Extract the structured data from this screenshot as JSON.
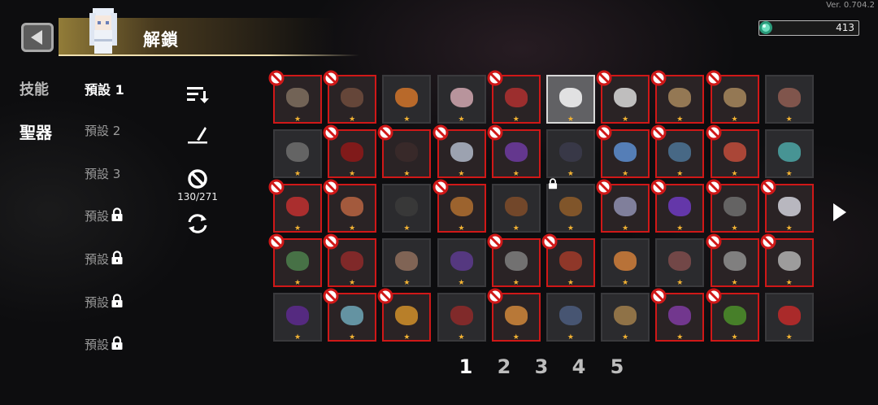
{
  "version": "Ver. 0.704.2",
  "header": {
    "title": "解鎖",
    "currency": "413"
  },
  "nav": {
    "categories": [
      "技能",
      "聖器"
    ],
    "active_category": "聖器"
  },
  "presets": [
    "預設 1",
    "預設 2",
    "預設 3",
    "預設",
    "預設",
    "預設",
    "預設"
  ],
  "unlock_count": "130/271",
  "pagination": [
    "1",
    "2",
    "3",
    "4",
    "5"
  ],
  "current_page": "1",
  "grid": {
    "items": [
      {
        "state": "locked",
        "color": "#7a6a5c"
      },
      {
        "state": "locked",
        "color": "#6b4a3c"
      },
      {
        "state": "normal",
        "color": "#c8702a"
      },
      {
        "state": "normal",
        "color": "#c8a0a8"
      },
      {
        "state": "locked",
        "color": "#a83030"
      },
      {
        "state": "selected",
        "color": "#f0f0f0"
      },
      {
        "state": "locked",
        "color": "#cfcfcf"
      },
      {
        "state": "locked",
        "color": "#a0825a"
      },
      {
        "state": "locked",
        "color": "#a0825a"
      },
      {
        "state": "normal",
        "color": "#8a5a50"
      },
      {
        "state": "normal",
        "color": "#6a6a6a"
      },
      {
        "state": "locked",
        "color": "#8a1a1a"
      },
      {
        "state": "locked",
        "color": "#3a2a2a"
      },
      {
        "state": "locked",
        "color": "#a8b0c0"
      },
      {
        "state": "locked",
        "color": "#6a3a9a"
      },
      {
        "state": "normal",
        "color": "#3a3a4a"
      },
      {
        "state": "locked",
        "color": "#5a88c8"
      },
      {
        "state": "locked",
        "color": "#4a7090"
      },
      {
        "state": "locked",
        "color": "#b84a3a"
      },
      {
        "state": "normal",
        "color": "#4aa0a0"
      },
      {
        "state": "locked",
        "color": "#b83030"
      },
      {
        "state": "locked",
        "color": "#b06040"
      },
      {
        "state": "normal",
        "color": "#3a3a3a"
      },
      {
        "state": "locked",
        "color": "#a86a30"
      },
      {
        "state": "normal",
        "color": "#7a4a2a"
      },
      {
        "state": "normal",
        "color": "#8a5a2a",
        "padlock": true
      },
      {
        "state": "locked",
        "color": "#8a8aa8"
      },
      {
        "state": "locked",
        "color": "#6a3ab8"
      },
      {
        "state": "locked",
        "color": "#6a6a6a"
      },
      {
        "state": "locked",
        "color": "#c8c8d0"
      },
      {
        "state": "locked",
        "color": "#4a7a4a"
      },
      {
        "state": "locked",
        "color": "#8a2a2a"
      },
      {
        "state": "normal",
        "color": "#8a6a5a"
      },
      {
        "state": "normal",
        "color": "#5a3a8a"
      },
      {
        "state": "locked",
        "color": "#7a7a7a"
      },
      {
        "state": "locked",
        "color": "#9a3a2a"
      },
      {
        "state": "normal",
        "color": "#c87a3a"
      },
      {
        "state": "normal",
        "color": "#7a4a4a"
      },
      {
        "state": "locked",
        "color": "#8a8a8a"
      },
      {
        "state": "locked",
        "color": "#aaaaaa"
      },
      {
        "state": "normal",
        "color": "#5a2a8a"
      },
      {
        "state": "locked",
        "color": "#6aa0b0"
      },
      {
        "state": "locked",
        "color": "#c88a2a"
      },
      {
        "state": "normal",
        "color": "#8a2a2a"
      },
      {
        "state": "locked",
        "color": "#c8823a"
      },
      {
        "state": "normal",
        "color": "#4a5a7a"
      },
      {
        "state": "normal",
        "color": "#9a7a4a"
      },
      {
        "state": "locked",
        "color": "#7a3a9a"
      },
      {
        "state": "locked",
        "color": "#4a8a2a"
      },
      {
        "state": "normal",
        "color": "#b82a2a"
      }
    ]
  }
}
